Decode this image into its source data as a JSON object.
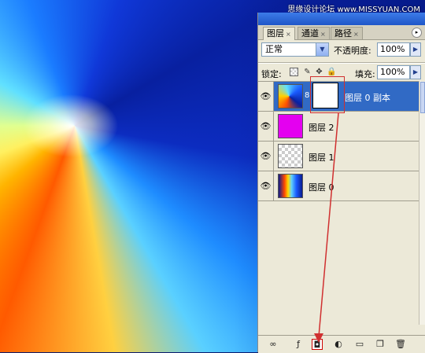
{
  "watermark": "思缘设计论坛 www.MISSYUAN.COM",
  "tabs": [
    {
      "label": "图层"
    },
    {
      "label": "通道"
    },
    {
      "label": "路径"
    }
  ],
  "blend": {
    "value": "正常",
    "arrow": "▼"
  },
  "opacity": {
    "label": "不透明度:",
    "value": "100%",
    "arrow": "▶"
  },
  "lock": {
    "label": "锁定:"
  },
  "fill": {
    "label": "填充:",
    "value": "100%",
    "arrow": "▶"
  },
  "layers": [
    {
      "name": "图层 0 副本",
      "selected": true
    },
    {
      "name": "图层 2"
    },
    {
      "name": "图层 1"
    },
    {
      "name": "图层 0"
    }
  ],
  "icons": {
    "eye": "👁",
    "chain": "8",
    "lock_brush": "✎",
    "lock_move": "✥",
    "lock_all": "🔒",
    "link": "∞",
    "fx": "ƒ",
    "mask": "◘",
    "adjust": "◐",
    "group": "▭",
    "new": "❐",
    "trash": "🗑",
    "menu": "▸"
  },
  "colors": {
    "selected": "#316ac5",
    "annotation": "#d03030"
  }
}
